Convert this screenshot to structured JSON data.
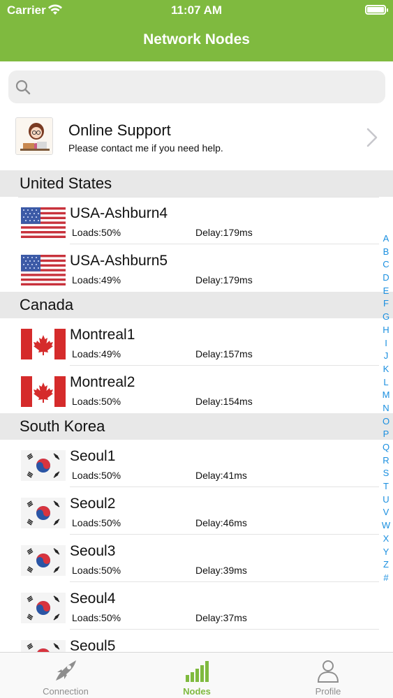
{
  "status": {
    "carrier": "Carrier",
    "time": "11:07 AM"
  },
  "nav": {
    "title": "Network Nodes"
  },
  "search": {
    "placeholder": ""
  },
  "support": {
    "title": "Online Support",
    "subtitle": "Please contact me if you need help."
  },
  "sections": [
    {
      "title": "United States",
      "flag": "usa-flag-icon",
      "nodes": [
        {
          "name": "USA-Ashburn4",
          "loads": "Loads:50%",
          "delay": "Delay:179ms"
        },
        {
          "name": "USA-Ashburn5",
          "loads": "Loads:49%",
          "delay": "Delay:179ms"
        }
      ]
    },
    {
      "title": "Canada",
      "flag": "canada-flag-icon",
      "nodes": [
        {
          "name": "Montreal1",
          "loads": "Loads:49%",
          "delay": "Delay:157ms"
        },
        {
          "name": "Montreal2",
          "loads": "Loads:50%",
          "delay": "Delay:154ms"
        }
      ]
    },
    {
      "title": "South Korea",
      "flag": "south-korea-flag-icon",
      "nodes": [
        {
          "name": "Seoul1",
          "loads": "Loads:50%",
          "delay": "Delay:41ms"
        },
        {
          "name": "Seoul2",
          "loads": "Loads:50%",
          "delay": "Delay:46ms"
        },
        {
          "name": "Seoul3",
          "loads": "Loads:50%",
          "delay": "Delay:39ms"
        },
        {
          "name": "Seoul4",
          "loads": "Loads:50%",
          "delay": "Delay:37ms"
        },
        {
          "name": "Seoul5",
          "loads": "",
          "delay": ""
        }
      ]
    }
  ],
  "index_letters": [
    "A",
    "B",
    "C",
    "D",
    "E",
    "F",
    "G",
    "H",
    "I",
    "J",
    "K",
    "L",
    "M",
    "N",
    "O",
    "P",
    "Q",
    "R",
    "S",
    "T",
    "U",
    "V",
    "W",
    "X",
    "Y",
    "Z",
    "#"
  ],
  "tabs": [
    {
      "label": "Connection",
      "icon": "rocket-icon",
      "active": false
    },
    {
      "label": "Nodes",
      "icon": "signal-bars-icon",
      "active": true
    },
    {
      "label": "Profile",
      "icon": "person-icon",
      "active": false
    }
  ],
  "colors": {
    "header_bg": "#7fba3f",
    "active_tab": "#7fba3f",
    "inactive_tab": "#8e8e8e",
    "index_letter": "#1a8fe0",
    "section_bg": "#e8e8e8"
  }
}
